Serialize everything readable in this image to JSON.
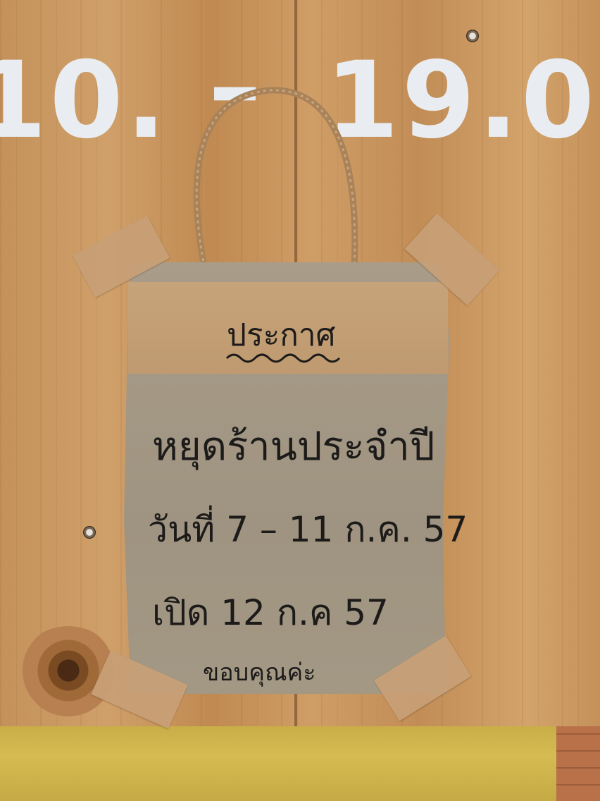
{
  "sign": {
    "hours": {
      "open": "10.",
      "dash": "–",
      "close": "19.0"
    }
  },
  "notice": {
    "title": "ประกาศ",
    "line1": "หยุดร้านประจำปี",
    "line2": "วันที่   7 – 11  ก.ค. 57",
    "line3": "เปิด  12  ก.ค  57",
    "line4": "ขอบคุณค่ะ"
  },
  "colors": {
    "wood": "#c8955d",
    "paper_bag": "#a59a86",
    "sign_letters": "#e9edf2",
    "ink": "#1d1b1a",
    "base": "#d2b64e"
  },
  "icons": [
    "screw",
    "tape"
  ]
}
